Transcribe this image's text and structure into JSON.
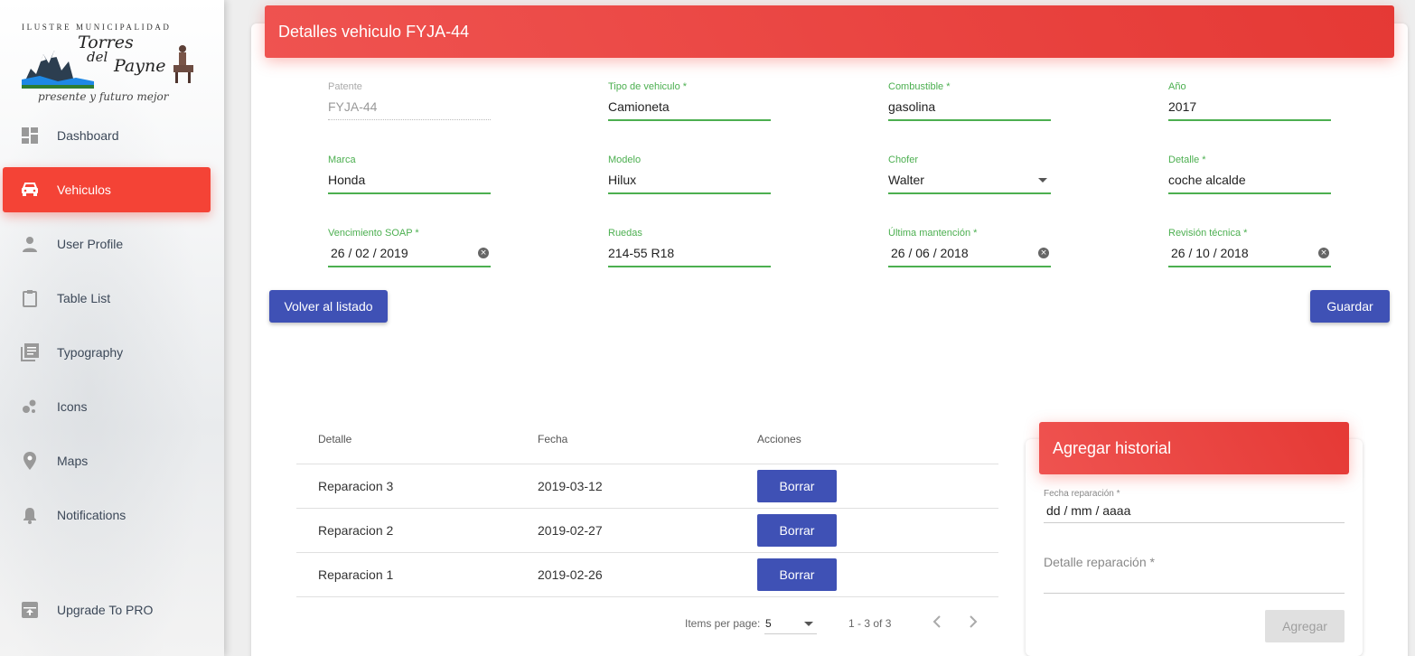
{
  "logo": {
    "top_text": "ILUSTRE MUNICIPALIDAD",
    "name_line1": "Torres",
    "name_line2": "del",
    "name_line3": "Payne",
    "tagline": "presente y futuro mejor"
  },
  "sidebar": {
    "items": [
      {
        "label": "Dashboard",
        "icon": "dashboard-icon"
      },
      {
        "label": "Vehiculos",
        "icon": "car-icon"
      },
      {
        "label": "User Profile",
        "icon": "person-icon"
      },
      {
        "label": "Table List",
        "icon": "clipboard-icon"
      },
      {
        "label": "Typography",
        "icon": "library-books-icon"
      },
      {
        "label": "Icons",
        "icon": "bubble-chart-icon"
      },
      {
        "label": "Maps",
        "icon": "location-pin-icon"
      },
      {
        "label": "Notifications",
        "icon": "bell-icon"
      }
    ],
    "upgrade": {
      "label": "Upgrade To PRO",
      "icon": "unarchive-icon"
    },
    "active_color": "#f44336"
  },
  "header": {
    "title": "Detalles vehiculo FYJA-44"
  },
  "form": {
    "patente": {
      "label": "Patente",
      "value": "FYJA-44"
    },
    "tipo": {
      "label": "Tipo de vehiculo *",
      "value": "Camioneta"
    },
    "combustible": {
      "label": "Combustible *",
      "value": "gasolina"
    },
    "anio": {
      "label": "Año",
      "value": "2017"
    },
    "marca": {
      "label": "Marca",
      "value": "Honda"
    },
    "modelo": {
      "label": "Modelo",
      "value": "Hilux"
    },
    "chofer": {
      "label": "Chofer",
      "value": "Walter"
    },
    "detalle": {
      "label": "Detalle *",
      "value": "coche alcalde"
    },
    "soap": {
      "label": "Vencimiento SOAP *",
      "value": "26 / 02 / 2019"
    },
    "ruedas": {
      "label": "Ruedas",
      "value": "214-55 R18"
    },
    "mantencion": {
      "label": "Última mantención *",
      "value": "26 / 06 / 2018"
    },
    "revision": {
      "label": "Revisión técnica *",
      "value": "26 / 10 / 2018"
    }
  },
  "buttons": {
    "back": "Volver al listado",
    "save": "Guardar"
  },
  "table": {
    "headers": [
      "Detalle",
      "Fecha",
      "Acciones"
    ],
    "rows": [
      {
        "detalle": "Reparacion 3",
        "fecha": "2019-03-12",
        "action": "Borrar"
      },
      {
        "detalle": "Reparacion 2",
        "fecha": "2019-02-27",
        "action": "Borrar"
      },
      {
        "detalle": "Reparacion 1",
        "fecha": "2019-02-26",
        "action": "Borrar"
      }
    ],
    "paginator": {
      "items_label": "Items per page:",
      "page_size": "5",
      "range": "1 - 3 of 3"
    }
  },
  "historial": {
    "title": "Agregar historial",
    "fecha_label": "Fecha reparación *",
    "fecha_value": "dd / mm / aaaa",
    "detalle_placeholder": "Detalle reparación *",
    "submit": "Agregar"
  },
  "colors": {
    "primary": "#3f51b5",
    "header_red": "#e53935",
    "valid_green": "#4caf50"
  }
}
